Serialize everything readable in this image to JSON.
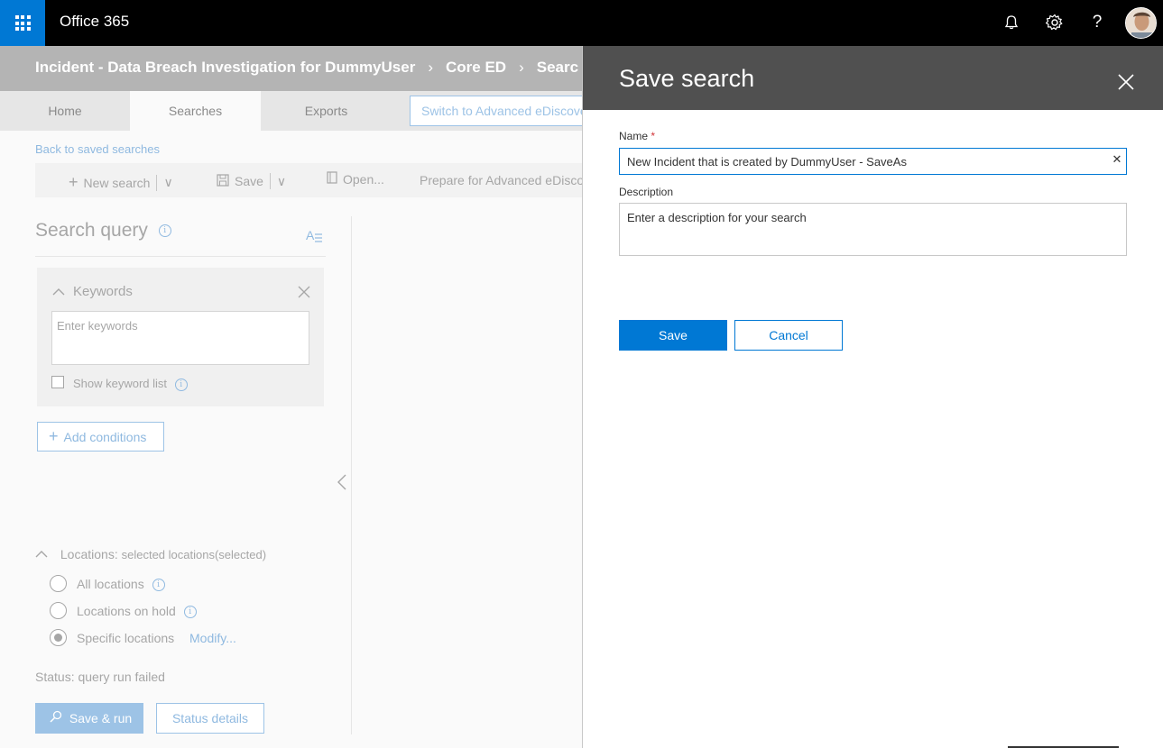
{
  "app": {
    "title": "Office 365"
  },
  "breadcrumb": {
    "items": [
      "Incident - Data Breach Investigation for DummyUser",
      "Core ED",
      "Searc"
    ]
  },
  "tabs": [
    {
      "label": "Home"
    },
    {
      "label": "Searches",
      "active": true
    },
    {
      "label": "Exports"
    }
  ],
  "switch_button": {
    "label": "Switch to Advanced eDiscove"
  },
  "back_link": "Back to saved searches",
  "commands": {
    "new_search": "New search",
    "save": "Save",
    "open": "Open...",
    "prepare": "Prepare for Advanced eDisco"
  },
  "query": {
    "title": "Search query",
    "keywords_label": "Keywords",
    "keywords_placeholder": "Enter keywords",
    "show_keyword_list": "Show keyword list",
    "add_conditions": "Add conditions"
  },
  "locations": {
    "heading": "Locations:",
    "heading_detail": "selected locations(selected)",
    "options": [
      {
        "label": "All locations",
        "selected": false
      },
      {
        "label": "Locations on hold",
        "selected": false
      },
      {
        "label": "Specific locations",
        "selected": true
      }
    ],
    "modify_link": "Modify..."
  },
  "status": {
    "text": "Status: query run failed"
  },
  "actions": {
    "save_run": "Save & run",
    "status_details": "Status details"
  },
  "panel": {
    "title": "Save search",
    "name_label": "Name",
    "required_mark": "*",
    "name_value": "New Incident that is created by DummyUser - SaveAs",
    "description_label": "Description",
    "description_placeholder": "Enter a description for your search",
    "save_label": "Save",
    "cancel_label": "Cancel"
  },
  "colors": {
    "brand_blue": "#0078d4",
    "top_bar": "#000000",
    "panel_header": "#505050",
    "breadcrumb_band": "#b4b4b4"
  },
  "icons": {
    "waffle": "app-launcher-icon",
    "bell": "bell-icon",
    "gear": "gear-icon",
    "help": "help-icon",
    "close": "close-icon"
  }
}
